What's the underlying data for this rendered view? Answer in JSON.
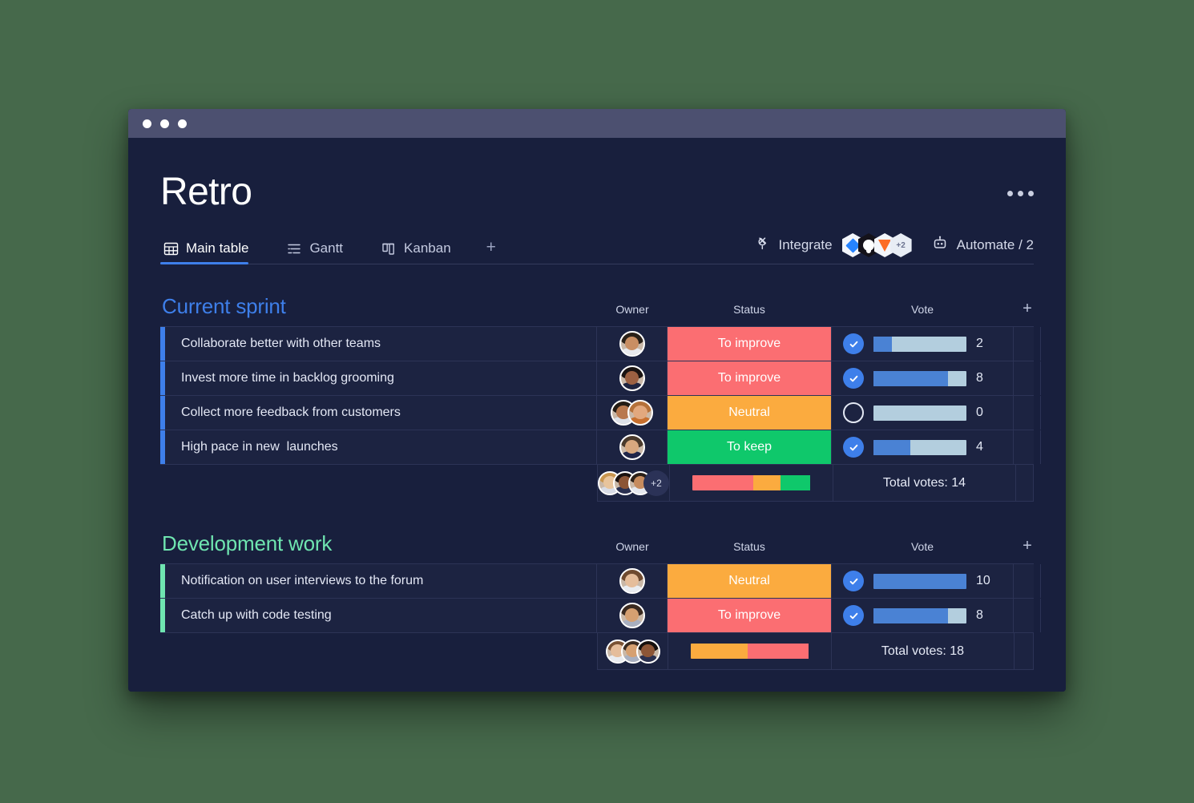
{
  "window": {
    "titlebar_dots": 3
  },
  "header": {
    "title": "Retro",
    "more_menu_icon": "ellipsis-icon"
  },
  "tabs": [
    {
      "label": "Main table",
      "icon": "grid-icon",
      "active": true
    },
    {
      "label": "Gantt",
      "icon": "gantt-icon",
      "active": false
    },
    {
      "label": "Kanban",
      "icon": "kanban-icon",
      "active": false
    }
  ],
  "tab_add_label": "+",
  "toolbar": {
    "integrate_label": "Integrate",
    "integrate_icon": "plug-icon",
    "automate_label": "Automate / 2",
    "automate_icon": "robot-icon",
    "integrations": [
      {
        "name": "jira",
        "label": ""
      },
      {
        "name": "github",
        "label": ""
      },
      {
        "name": "gitlab",
        "label": ""
      },
      {
        "name": "more",
        "label": "+2"
      }
    ]
  },
  "columns": {
    "owner": "Owner",
    "status": "Status",
    "vote": "Vote",
    "add": "+"
  },
  "colors": {
    "accent_blue": "#3E7FEA",
    "accent_green": "#6FE5B0",
    "status_improve": "#FB6E72",
    "status_neutral": "#FBAB3F",
    "status_keep": "#0FC86B",
    "vote_fill": "#4A82D4",
    "vote_track": "#B3CEDE",
    "page_bg": "#181F3D",
    "row_bg": "#1C2341",
    "titlebar": "#4C5070",
    "desktop_bg": "#46694B"
  },
  "groups": [
    {
      "title": "Current sprint",
      "color": "#3E7FEA",
      "accent_class": "group-blue",
      "items": [
        {
          "title": "Collaborate better with other teams",
          "owners": [
            {
              "hair": "#2A2119",
              "skin": "#C98E63",
              "shirt": "#E8EAEE"
            }
          ],
          "status": "To improve",
          "status_color": "#FB6E72",
          "voted": true,
          "vote_pct": 20,
          "vote_count": "2"
        },
        {
          "title": "Invest more time in backlog grooming",
          "owners": [
            {
              "hair": "#1A1412",
              "skin": "#9C6142",
              "shirt": "#1E2440"
            }
          ],
          "status": "To improve",
          "status_color": "#FB6E72",
          "voted": true,
          "vote_pct": 80,
          "vote_count": "8"
        },
        {
          "title": "Collect more feedback from customers",
          "owners": [
            {
              "hair": "#231B14",
              "skin": "#B9794F",
              "shirt": "#DCE0E8"
            },
            {
              "hair": "#B5713A",
              "skin": "#E2A87E",
              "shirt": "#C8702F"
            }
          ],
          "status": "Neutral",
          "status_color": "#FBAB3F",
          "voted": false,
          "vote_pct": 0,
          "vote_count": "0"
        },
        {
          "title": "High pace in new  launches",
          "owners": [
            {
              "hair": "#4A3A2C",
              "skin": "#D8A87F",
              "shirt": "#20264A"
            }
          ],
          "status": "To keep",
          "status_color": "#0FC86B",
          "voted": true,
          "vote_pct": 40,
          "vote_count": "4"
        }
      ],
      "summary": {
        "avatars": [
          {
            "hair": "#C9964F",
            "skin": "#E8C49C",
            "shirt": "#D8DCE6"
          },
          {
            "hair": "#1A1210",
            "skin": "#8C5536",
            "shirt": "#2A3050"
          },
          {
            "hair": "#2B2018",
            "skin": "#C68B5E",
            "shirt": "#E4E7EE"
          }
        ],
        "extra_label": "+2",
        "segments": [
          {
            "color": "#FB6E72",
            "pct": 52
          },
          {
            "color": "#FBAB3F",
            "pct": 23
          },
          {
            "color": "#0FC86B",
            "pct": 25
          }
        ],
        "total_label": "Total votes: 14"
      }
    },
    {
      "title": "Development work",
      "color": "#6FE5B0",
      "accent_class": "group-green",
      "items": [
        {
          "title": "Notification on user interviews to the forum",
          "owners": [
            {
              "hair": "#6E4A30",
              "skin": "#E5BD9B",
              "shirt": "#E9ECF1"
            }
          ],
          "status": "Neutral",
          "status_color": "#FBAB3F",
          "voted": true,
          "vote_pct": 100,
          "vote_count": "10"
        },
        {
          "title": "Catch up with code testing",
          "owners": [
            {
              "hair": "#3A2A20",
              "skin": "#D6A071",
              "shirt": "#A8AFC0"
            }
          ],
          "status": "To improve",
          "status_color": "#FB6E72",
          "voted": true,
          "vote_pct": 80,
          "vote_count": "8"
        }
      ],
      "summary": {
        "avatars": [
          {
            "hair": "#7A5234",
            "skin": "#E5BD9B",
            "shirt": "#E9ECF1"
          },
          {
            "hair": "#3A2A20",
            "skin": "#D6A071",
            "shirt": "#A8AFC0"
          },
          {
            "hair": "#15100E",
            "skin": "#8C5536",
            "shirt": "#2A3050"
          }
        ],
        "extra_label": "",
        "segments": [
          {
            "color": "#FBAB3F",
            "pct": 48
          },
          {
            "color": "#FB6E72",
            "pct": 52
          }
        ],
        "total_label": "Total votes: 18"
      }
    }
  ]
}
